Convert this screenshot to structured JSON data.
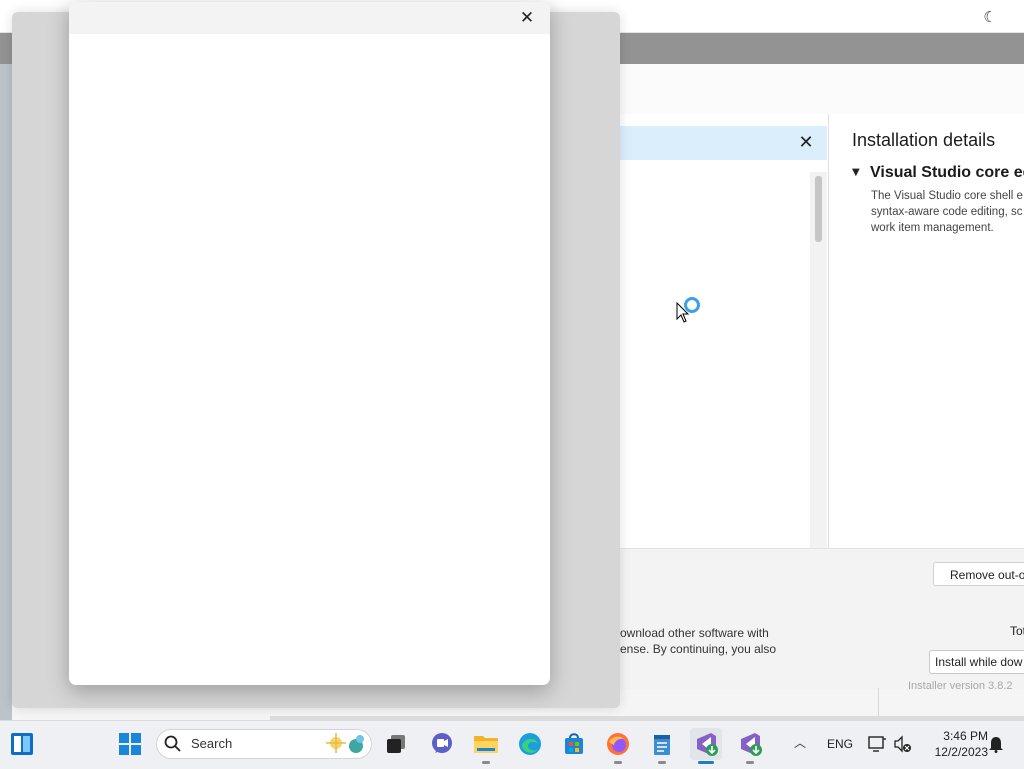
{
  "installer": {
    "theme_icon": "moon-icon",
    "info_close_icon": "close-icon",
    "details_title": "Installation details",
    "section_title": "Visual Studio core edi",
    "section_desc": [
      "The Visual Studio core shell e",
      "syntax-aware code editing, sc",
      "work item management."
    ],
    "remove_button": "Remove out-o",
    "license_lines": [
      "ownload other software with",
      "ense. By continuing, you also"
    ],
    "total_label": "Tot",
    "install_option": "Install while dow",
    "version_text": "Installer version 3.8.2"
  },
  "dialog": {
    "close_icon": "close-icon"
  },
  "taskbar": {
    "search_placeholder": "Search",
    "language": "ENG",
    "time": "3:46 PM",
    "date": "12/2/2023",
    "apps": [
      "widgets",
      "start",
      "search",
      "task-view",
      "chat",
      "file-explorer",
      "edge",
      "store",
      "firefox",
      "notepad",
      "visual-studio-installer",
      "visual-studio"
    ]
  }
}
